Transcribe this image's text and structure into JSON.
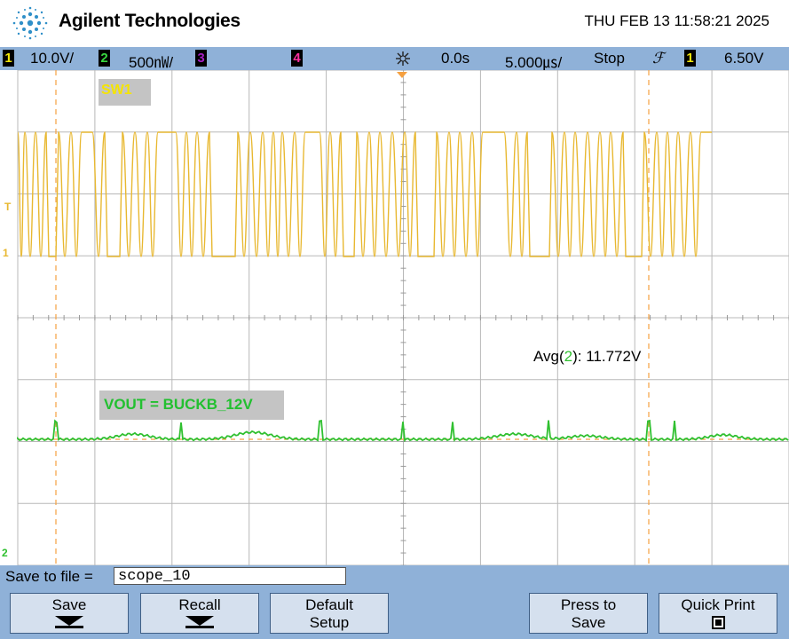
{
  "header": {
    "brand": "Agilent Technologies",
    "datetime": "THU FEB 13 11:58:21 2025"
  },
  "status_bar": {
    "ch1": {
      "number": "1",
      "scale": "10.0V/",
      "color": "#f2e70a"
    },
    "ch2": {
      "number": "2",
      "scale": "500㎻/",
      "color": "#38d640"
    },
    "ch3": {
      "number": "3",
      "color": "#a51fc4"
    },
    "ch4": {
      "number": "4",
      "color": "#ff2fa0"
    },
    "trigger_icon": "trigger-icon",
    "delay": "0.0s",
    "timebase": "5.000㎲/",
    "run_state": "Stop",
    "slope": "ℱ",
    "trig_ch": "1",
    "trig_level": "6.50V"
  },
  "screen": {
    "ch1_label": "SW1",
    "ch2_label": "VOUT = BUCKB_12V",
    "measurement_prefix": "Avg(",
    "measurement_channel": "2",
    "measurement_suffix": "): 11.772V",
    "ch1_color": "#e8b830",
    "ch2_color": "#30c030",
    "marker_T": "T",
    "marker_1": "1",
    "marker_2": "2"
  },
  "bottom": {
    "save_to_file_label": "Save to file =",
    "filename": "scope_10",
    "softkeys": [
      {
        "label": "Save"
      },
      {
        "label": "Recall"
      },
      {
        "label_line1": "Default",
        "label_line2": "Setup"
      },
      {
        "label_line1": "Press to",
        "label_line2": "Save"
      },
      {
        "label": "Quick Print"
      }
    ]
  }
}
